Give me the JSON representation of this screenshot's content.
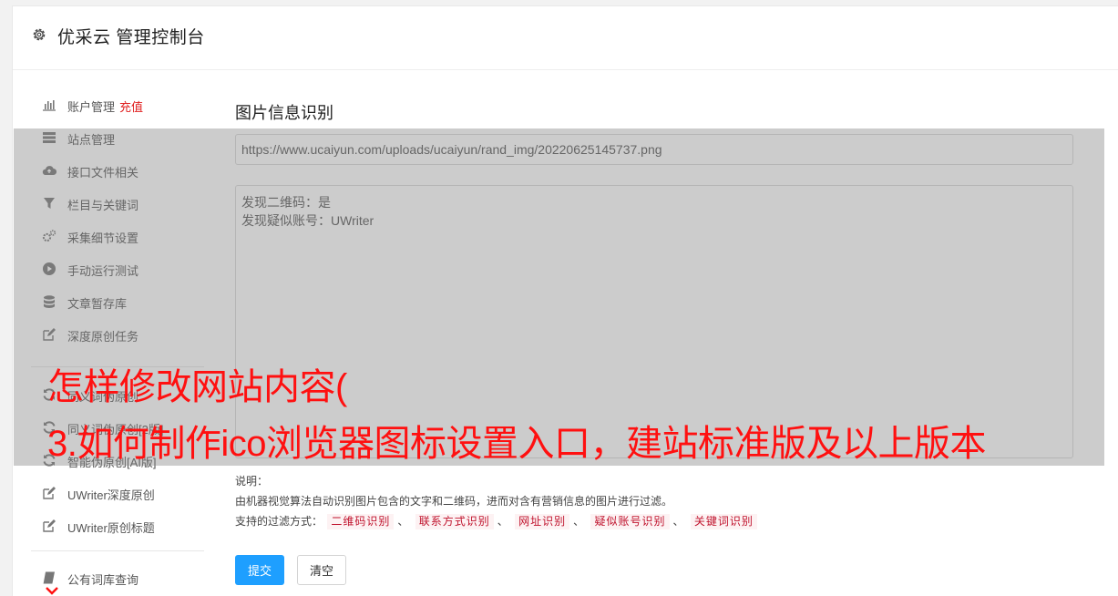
{
  "header": {
    "title": "优采云 管理控制台",
    "icon": "gear-icon"
  },
  "sidebar": {
    "items": [
      {
        "label": "账户管理",
        "extra": "充值",
        "icon": "bar-chart-icon"
      },
      {
        "label": "站点管理",
        "icon": "server-icon"
      },
      {
        "label": "接口文件相关",
        "icon": "cloud-upload-icon"
      },
      {
        "label": "栏目与关键词",
        "icon": "filter-icon"
      },
      {
        "label": "采集细节设置",
        "icon": "gears-icon"
      },
      {
        "label": "手动运行测试",
        "icon": "play-circle-icon"
      },
      {
        "label": "文章暂存库",
        "icon": "database-icon"
      },
      {
        "label": "深度原创任务",
        "icon": "edit-icon"
      },
      {
        "label": "同义词伪原创",
        "icon": "refresh-icon"
      },
      {
        "label": "同义词伪原创[2版]",
        "icon": "refresh-icon"
      },
      {
        "label": "智能伪原创[AI版]",
        "icon": "refresh-icon"
      },
      {
        "label": "UWriter深度原创",
        "icon": "edit-icon"
      },
      {
        "label": "UWriter原创标题",
        "icon": "edit-icon"
      },
      {
        "label": "公有词库查询",
        "icon": "book-icon"
      }
    ]
  },
  "main": {
    "title": "图片信息识别",
    "url_value": "https://www.ucaiyun.com/uploads/ucaiyun/rand_img/20220625145737.png",
    "result_lines": [
      "发现二维码：是",
      "发现疑似账号：UWriter"
    ],
    "desc_label": "说明：",
    "desc_text": "由机器视觉算法自动识别图片包含的文字和二维码，进而对含有营销信息的图片进行过滤。",
    "filter_label": "支持的过滤方式：",
    "filters": [
      "二维码识别",
      "联系方式识别",
      "网址识别",
      "疑似账号识别",
      "关键词识别"
    ],
    "filter_sep": "、",
    "submit_label": "提交",
    "clear_label": "清空"
  },
  "overlay_caption": {
    "line1": "怎样修改网站内容(",
    "line2": "3.如何制作ico浏览器图标设置入口，建站标准版及以上版本"
  },
  "colors": {
    "accent": "#1e9fff",
    "caption": "#ff1010",
    "tag_text": "#c0142e",
    "recharge": "#e02020"
  }
}
